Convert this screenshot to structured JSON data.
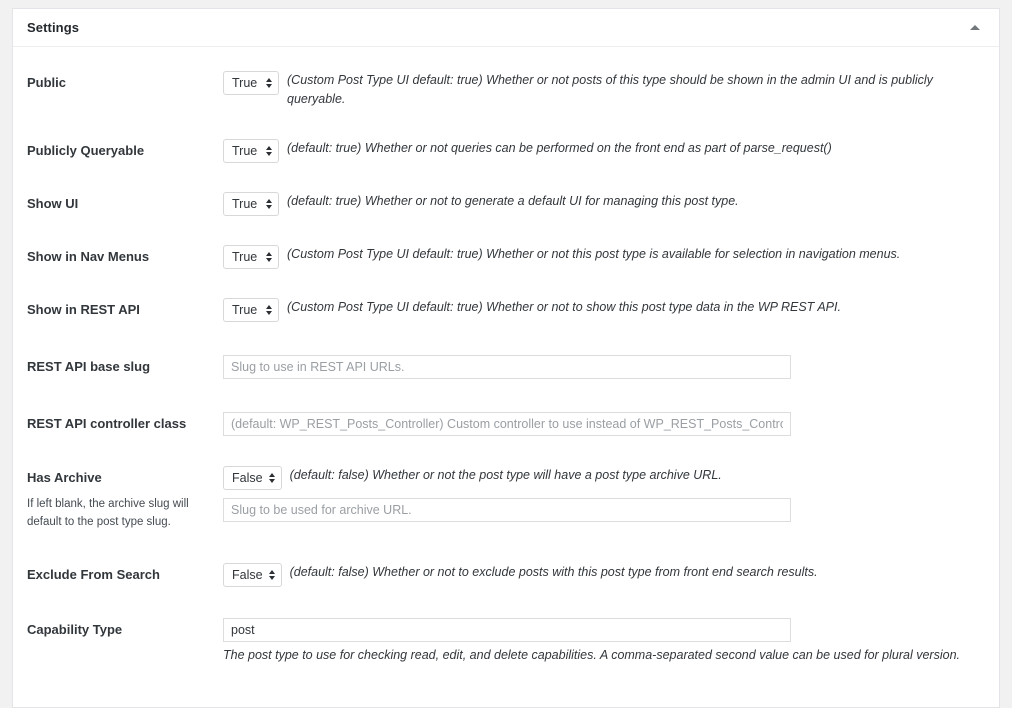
{
  "panel": {
    "title": "Settings",
    "toggle_icon": "caret-up-icon"
  },
  "fields": {
    "public": {
      "label": "Public",
      "select_value": "True",
      "description": "(Custom Post Type UI default: true) Whether or not posts of this type should be shown in the admin UI and is publicly queryable."
    },
    "publicly_queryable": {
      "label": "Publicly Queryable",
      "select_value": "True",
      "description": "(default: true) Whether or not queries can be performed on the front end as part of parse_request()"
    },
    "show_ui": {
      "label": "Show UI",
      "select_value": "True",
      "description": "(default: true) Whether or not to generate a default UI for managing this post type."
    },
    "show_in_nav_menus": {
      "label": "Show in Nav Menus",
      "select_value": "True",
      "description": "(Custom Post Type UI default: true) Whether or not this post type is available for selection in navigation menus."
    },
    "show_in_rest_api": {
      "label": "Show in REST API",
      "select_value": "True",
      "description": "(Custom Post Type UI default: true) Whether or not to show this post type data in the WP REST API."
    },
    "rest_api_base_slug": {
      "label": "REST API base slug",
      "value": "",
      "placeholder": "Slug to use in REST API URLs."
    },
    "rest_api_controller_class": {
      "label": "REST API controller class",
      "value": "",
      "placeholder": "(default: WP_REST_Posts_Controller) Custom controller to use instead of WP_REST_Posts_Controller."
    },
    "has_archive": {
      "label": "Has Archive",
      "sublabel": "If left blank, the archive slug will default to the post type slug.",
      "select_value": "False",
      "description": "(default: false) Whether or not the post type will have a post type archive URL.",
      "slug_value": "",
      "slug_placeholder": "Slug to be used for archive URL."
    },
    "exclude_from_search": {
      "label": "Exclude From Search",
      "select_value": "False",
      "description": "(default: false) Whether or not to exclude posts with this post type from front end search results."
    },
    "capability_type": {
      "label": "Capability Type",
      "value": "post",
      "description": "The post type to use for checking read, edit, and delete capabilities. A comma-separated second value can be used for plural version."
    }
  },
  "select_options": [
    "True",
    "False"
  ],
  "colors": {
    "page_background": "#f1f1f1",
    "panel_background": "#ffffff",
    "panel_border": "#e2e4e7",
    "label_text": "#32373c",
    "placeholder_text": "#9a9fa4"
  }
}
